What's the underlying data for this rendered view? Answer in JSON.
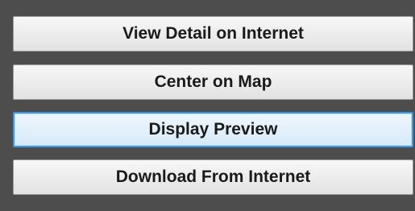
{
  "buttons": {
    "view_detail": "View Detail on Internet",
    "center_on_map": "Center on Map",
    "display_preview": "Display Preview",
    "download": "Download From Internet"
  },
  "colors": {
    "panel_background": "#4d4d4d",
    "button_face": "#eeeeee",
    "focus_border": "#3c98e3"
  }
}
